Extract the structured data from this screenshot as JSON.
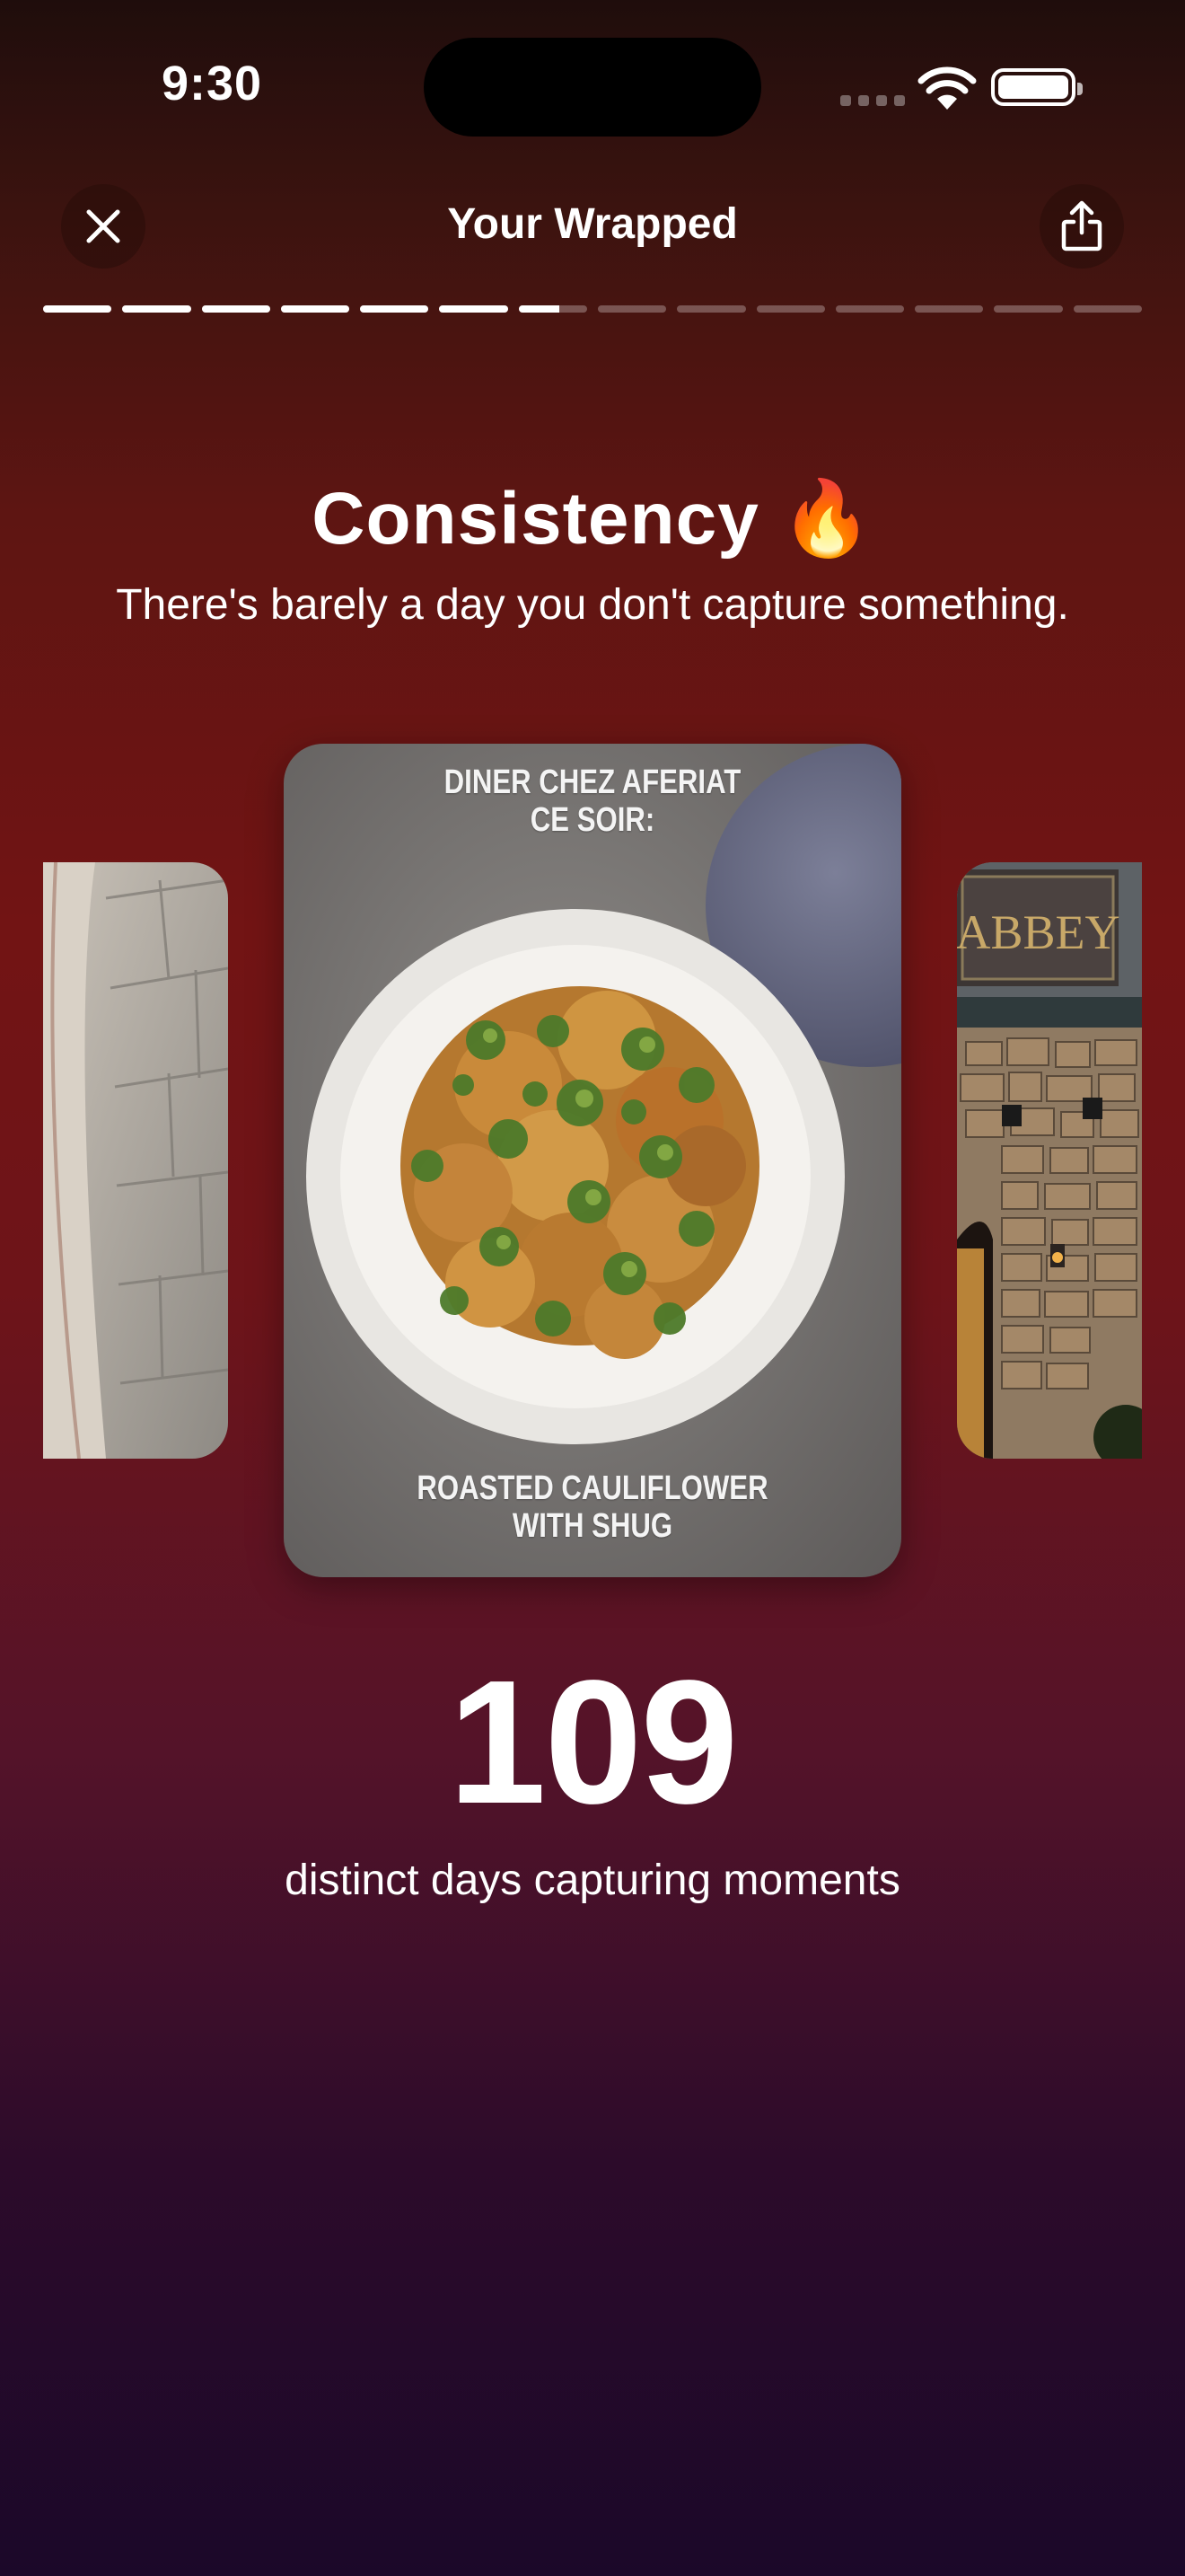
{
  "status_bar": {
    "time": "9:30",
    "icons": [
      "cellular-signal-icon",
      "wifi-icon",
      "battery-icon"
    ]
  },
  "nav": {
    "title": "Your Wrapped",
    "close_icon": "close-icon",
    "share_icon": "share-icon"
  },
  "progress": {
    "total_segments": 14,
    "completed_segments": 6,
    "current_segment_fraction": 0.6
  },
  "slide": {
    "title": "Consistency",
    "title_emoji": "🔥",
    "subtitle": "There's barely a day you don't capture something.",
    "stat_value": "109",
    "stat_label": "distinct days capturing moments"
  },
  "photos": {
    "center": {
      "caption_top": "DINER CHEZ AFERIAT\nCE SOIR:",
      "caption_bottom": "ROASTED CAULIFLOWER\nWITH SHUG"
    },
    "right": {
      "sign_text": "ABBEY"
    }
  },
  "colors": {
    "bg_top": "#1f0d0c",
    "bg_mid": "#721414",
    "bg_bottom": "#1b0829",
    "text": "#ffffff"
  }
}
